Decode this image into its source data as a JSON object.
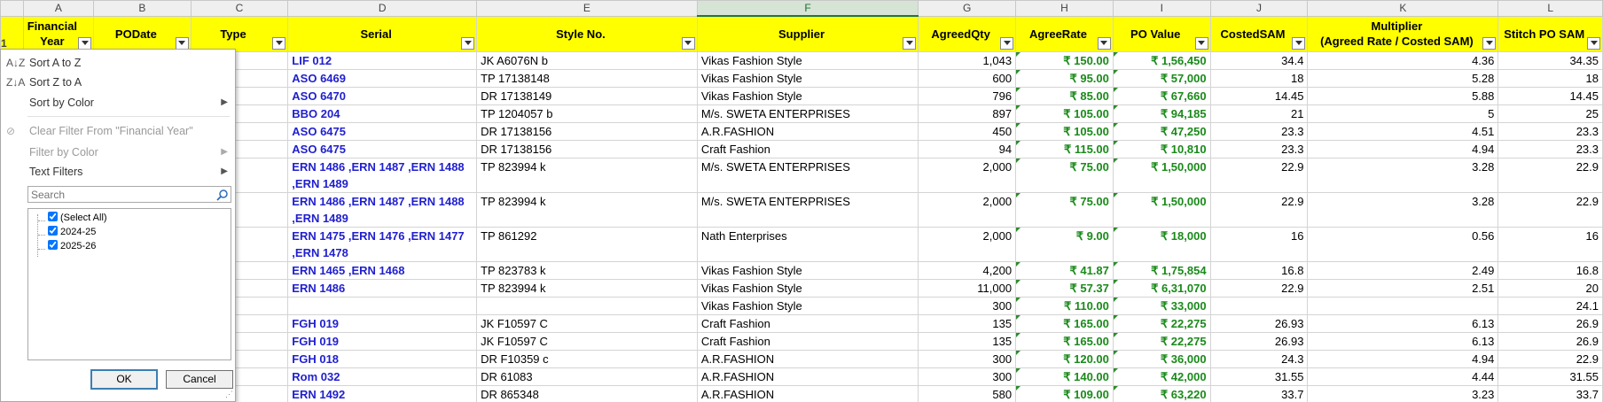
{
  "columns": [
    "A",
    "B",
    "C",
    "D",
    "E",
    "F",
    "G",
    "H",
    "I",
    "J",
    "K",
    "L"
  ],
  "selected_column": "F",
  "header_row_number": "1",
  "headers": [
    "Financial Year",
    "PODate",
    "Type",
    "Serial",
    "Style No.",
    "Supplier",
    "AgreedQty",
    "AgreeRate",
    "PO Value",
    "CostedSAM",
    "Multiplier\n(Agreed Rate / Costed SAM)",
    "Stitch PO SAM"
  ],
  "rows": [
    {
      "serial": "LIF 012",
      "style": "JK A6076N b",
      "supplier": "Vikas Fashion Style",
      "qty": "1,043",
      "rate": "₹ 150.00",
      "value": "₹ 1,56,450",
      "sam": "34.4",
      "mult": "4.36",
      "stitch": "34.35"
    },
    {
      "serial": "ASO 6469",
      "style": "TP 17138148",
      "supplier": "Vikas Fashion Style",
      "qty": "600",
      "rate": "₹ 95.00",
      "value": "₹ 57,000",
      "sam": "18",
      "mult": "5.28",
      "stitch": "18"
    },
    {
      "serial": "ASO 6470",
      "style": "DR 17138149",
      "supplier": "Vikas Fashion Style",
      "qty": "796",
      "rate": "₹ 85.00",
      "value": "₹ 67,660",
      "sam": "14.45",
      "mult": "5.88",
      "stitch": "14.45"
    },
    {
      "serial": "BBO 204",
      "style": "TP 1204057 b",
      "supplier": "M/s. SWETA ENTERPRISES",
      "qty": "897",
      "rate": "₹ 105.00",
      "value": "₹ 94,185",
      "sam": "21",
      "mult": "5",
      "stitch": "25"
    },
    {
      "serial": "ASO 6475",
      "style": "DR 17138156",
      "supplier": "A.R.FASHION",
      "qty": "450",
      "rate": "₹ 105.00",
      "value": "₹ 47,250",
      "sam": "23.3",
      "mult": "4.51",
      "stitch": "23.3"
    },
    {
      "serial": "ASO 6475",
      "style": "DR 17138156",
      "supplier": "Craft Fashion",
      "qty": "94",
      "rate": "₹ 115.00",
      "value": "₹ 10,810",
      "sam": "23.3",
      "mult": "4.94",
      "stitch": "23.3"
    },
    {
      "serial": "ERN 1486 ,ERN 1487 ,ERN 1488 ,ERN 1489",
      "style": "TP 823994 k",
      "supplier": "M/s. SWETA ENTERPRISES",
      "qty": "2,000",
      "rate": "₹ 75.00",
      "value": "₹ 1,50,000",
      "sam": "22.9",
      "mult": "3.28",
      "stitch": "22.9",
      "tall": true
    },
    {
      "serial": "ERN 1486 ,ERN 1487 ,ERN 1488 ,ERN 1489",
      "style": "TP 823994 k",
      "supplier": "M/s. SWETA ENTERPRISES",
      "qty": "2,000",
      "rate": "₹ 75.00",
      "value": "₹ 1,50,000",
      "sam": "22.9",
      "mult": "3.28",
      "stitch": "22.9",
      "tall": true
    },
    {
      "serial": "ERN 1475 ,ERN 1476 ,ERN 1477 ,ERN 1478",
      "style": "TP 861292",
      "supplier": "Nath Enterprises",
      "qty": "2,000",
      "rate": "₹ 9.00",
      "value": "₹ 18,000",
      "sam": "16",
      "mult": "0.56",
      "stitch": "16",
      "tall": true
    },
    {
      "serial": "ERN 1465 ,ERN 1468",
      "style": "TP 823783 k",
      "supplier": "Vikas Fashion Style",
      "qty": "4,200",
      "rate": "₹ 41.87",
      "value": "₹ 1,75,854",
      "sam": "16.8",
      "mult": "2.49",
      "stitch": "16.8"
    },
    {
      "serial": "ERN 1486",
      "style": "TP 823994 k",
      "supplier": "Vikas Fashion Style",
      "qty": "11,000",
      "rate": "₹ 57.37",
      "value": "₹ 6,31,070",
      "sam": "22.9",
      "mult": "2.51",
      "stitch": "20"
    },
    {
      "serial": "",
      "style": "",
      "supplier": "Vikas Fashion Style",
      "qty": "300",
      "rate": "₹ 110.00",
      "value": "₹ 33,000",
      "sam": "",
      "mult": "",
      "stitch": "24.1"
    },
    {
      "serial": "FGH 019",
      "style": "JK F10597 C",
      "supplier": "Craft Fashion",
      "qty": "135",
      "rate": "₹ 165.00",
      "value": "₹ 22,275",
      "sam": "26.93",
      "mult": "6.13",
      "stitch": "26.9"
    },
    {
      "serial": "FGH 019",
      "style": "JK F10597 C",
      "supplier": "Craft Fashion",
      "qty": "135",
      "rate": "₹ 165.00",
      "value": "₹ 22,275",
      "sam": "26.93",
      "mult": "6.13",
      "stitch": "26.9"
    },
    {
      "serial": "FGH 018",
      "style": "DR F10359 c",
      "supplier": "A.R.FASHION",
      "qty": "300",
      "rate": "₹ 120.00",
      "value": "₹ 36,000",
      "sam": "24.3",
      "mult": "4.94",
      "stitch": "22.9"
    },
    {
      "serial": "Rom 032",
      "style": "DR 61083",
      "supplier": "A.R.FASHION",
      "qty": "300",
      "rate": "₹ 140.00",
      "value": "₹ 42,000",
      "sam": "31.55",
      "mult": "4.44",
      "stitch": "31.55"
    },
    {
      "serial": "ERN 1492",
      "style": "DR 865348",
      "supplier": "A.R.FASHION",
      "qty": "580",
      "rate": "₹ 109.00",
      "value": "₹ 63,220",
      "sam": "33.7",
      "mult": "3.23",
      "stitch": "33.7"
    }
  ],
  "filter_menu": {
    "sort_az": "Sort A to Z",
    "sort_za": "Sort Z to A",
    "sort_color": "Sort by Color",
    "clear_filter": "Clear Filter From \"Financial Year\"",
    "filter_color": "Filter by Color",
    "text_filters": "Text Filters",
    "search_placeholder": "Search",
    "items": [
      {
        "label": "(Select All)",
        "checked": true
      },
      {
        "label": "2024-25",
        "checked": true
      },
      {
        "label": "2025-26",
        "checked": true
      }
    ],
    "ok": "OK",
    "cancel": "Cancel"
  }
}
